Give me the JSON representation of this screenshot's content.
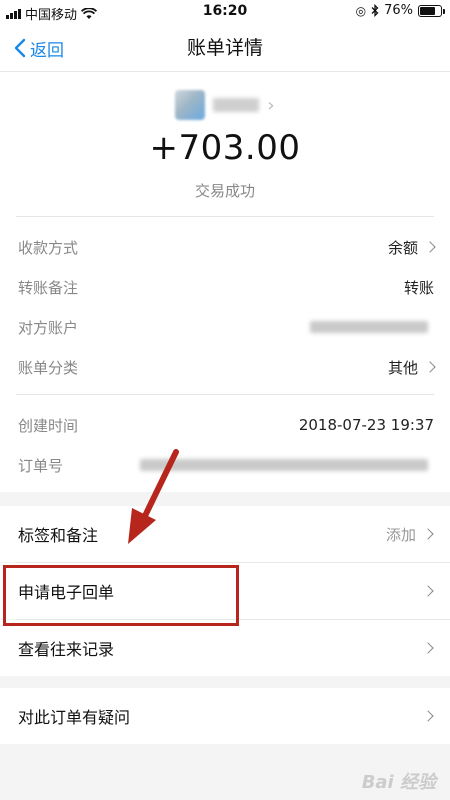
{
  "status_bar": {
    "carrier": "中国移动",
    "time": "16:20",
    "battery": "76%",
    "battery_level": 0.76
  },
  "nav": {
    "back_label": "返回",
    "title": "账单详情"
  },
  "transaction": {
    "amount": "+703.00",
    "status": "交易成功"
  },
  "details": [
    {
      "label": "收款方式",
      "value": "余额"
    },
    {
      "label": "转账备注",
      "value": "转账"
    },
    {
      "label": "对方账户",
      "value": ""
    },
    {
      "label": "账单分类",
      "value": "其他"
    }
  ],
  "meta": [
    {
      "label": "创建时间",
      "value": "2018-07-23 19:37"
    },
    {
      "label": "订单号",
      "value": ""
    }
  ],
  "actions": {
    "tags_label": "标签和备注",
    "tags_value": "添加",
    "receipt_label": "申请电子回单",
    "history_label": "查看往来记录",
    "question_label": "对此订单有疑问"
  },
  "annotation": {
    "arrow_color": "#b7261d",
    "box_color": "#b7261d"
  },
  "watermark": "Bai 经验",
  "colors": {
    "accent": "#1a88e6",
    "muted": "#888888"
  }
}
